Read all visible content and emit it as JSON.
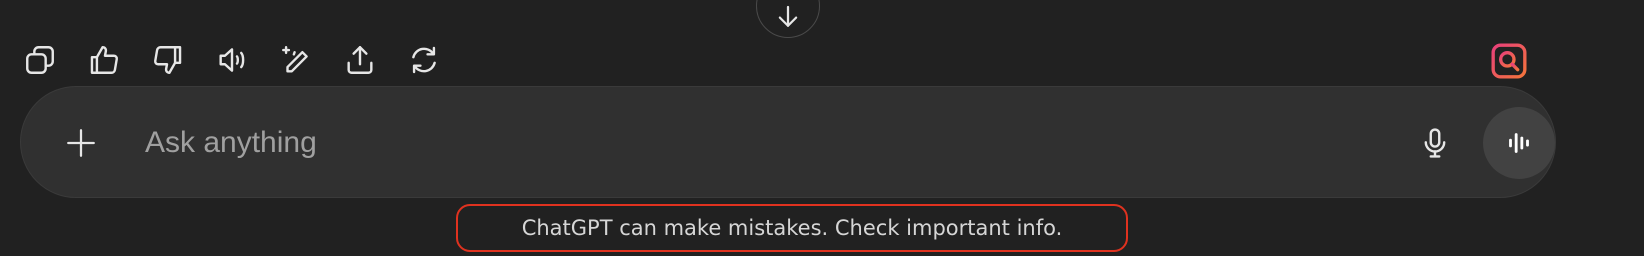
{
  "scroll": {
    "icon": "arrow-down-icon"
  },
  "message_actions": [
    {
      "name": "copy-button",
      "icon": "copy-icon"
    },
    {
      "name": "thumbs-up-button",
      "icon": "thumbs-up-icon"
    },
    {
      "name": "thumbs-down-button",
      "icon": "thumbs-down-icon"
    },
    {
      "name": "read-aloud-button",
      "icon": "speaker-icon"
    },
    {
      "name": "edit-in-canvas-button",
      "icon": "pencil-sparkle-icon"
    },
    {
      "name": "share-button",
      "icon": "share-upload-icon"
    },
    {
      "name": "regenerate-button",
      "icon": "refresh-icon"
    }
  ],
  "extension": {
    "icon": "search-refresh-icon",
    "accent": "#f4743b",
    "accent2": "#e8407a"
  },
  "composer": {
    "placeholder": "Ask anything",
    "value": "",
    "attach_icon": "plus-icon",
    "mic_icon": "microphone-icon",
    "voice_icon": "voice-mode-icon"
  },
  "footer": {
    "disclaimer": "ChatGPT can make mistakes. Check important info.",
    "highlight_color": "#e0321f"
  },
  "colors": {
    "background": "#212121",
    "composer": "#303030",
    "icon": "#e6e6e6",
    "placeholder": "#a0a0a0"
  }
}
